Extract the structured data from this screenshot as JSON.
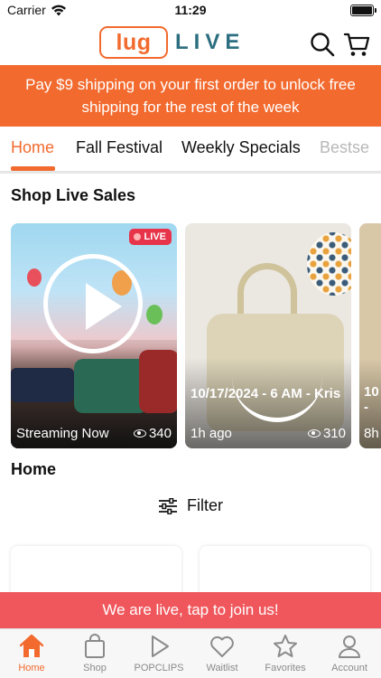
{
  "status_bar": {
    "carrier": "Carrier",
    "time": "11:29"
  },
  "header": {
    "logo_left": "lug",
    "logo_right": "LIVE",
    "icons": [
      "search-icon",
      "cart-icon"
    ]
  },
  "promo": {
    "text": "Pay $9 shipping on your first order to unlock free shipping for the rest of the week"
  },
  "tabs": [
    {
      "label": "Home",
      "active": true
    },
    {
      "label": "Fall Festival"
    },
    {
      "label": "Weekly Specials"
    },
    {
      "label": "Bestse"
    }
  ],
  "live_sales": {
    "title": "Shop Live Sales",
    "cards": [
      {
        "badge": "LIVE",
        "status": "Streaming Now",
        "views": "340"
      },
      {
        "date": "10/17/2024 - 6 AM - Kris",
        "ago": "1h ago",
        "views": "310"
      },
      {
        "date": "10",
        "dash": "-",
        "ago": "8h"
      }
    ]
  },
  "home_section": {
    "title": "Home",
    "filter_label": "Filter"
  },
  "join_bar": {
    "text": "We are live, tap to join us!"
  },
  "bottom_nav": [
    {
      "label": "Home",
      "icon": "home-icon",
      "active": true
    },
    {
      "label": "Shop",
      "icon": "shopping-bag-icon"
    },
    {
      "label": "POPCLIPS",
      "icon": "play-icon"
    },
    {
      "label": "Waitlist",
      "icon": "heart-icon"
    },
    {
      "label": "Favorites",
      "icon": "star-icon"
    },
    {
      "label": "Account",
      "icon": "person-icon"
    }
  ],
  "colors": {
    "brand_orange": "#f26a2e",
    "live_red": "#e7344a",
    "join_bar": "#f0575c",
    "logo_teal": "#2c6f80"
  }
}
